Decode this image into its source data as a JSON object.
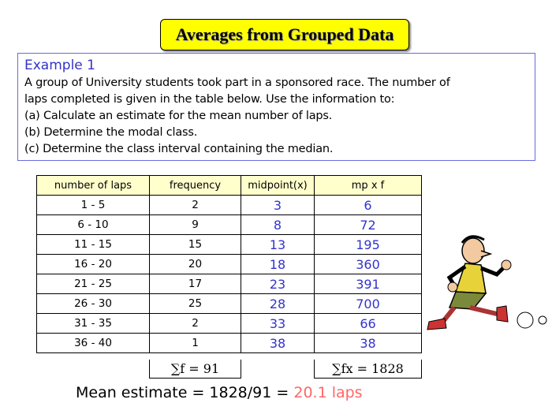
{
  "title": "Averages from Grouped Data",
  "example": {
    "heading": "Example 1",
    "lines": [
      "A group of University students took part in a sponsored race. The number of",
      "laps completed is given in the table below. Use the information to:",
      "(a) Calculate an estimate for the mean number of laps.",
      "(b) Determine the modal class.",
      "(c) Determine the class interval containing the median."
    ]
  },
  "table": {
    "headers": [
      "number of laps",
      "frequency",
      "midpoint(x)",
      "mp x f"
    ],
    "rows": [
      [
        "1 - 5",
        "2",
        "3",
        "6"
      ],
      [
        "6 - 10",
        "9",
        "8",
        "72"
      ],
      [
        "11 - 15",
        "15",
        "13",
        "195"
      ],
      [
        "16 - 20",
        "20",
        "18",
        "360"
      ],
      [
        "21 - 25",
        "17",
        "23",
        "391"
      ],
      [
        "26 - 30",
        "25",
        "28",
        "700"
      ],
      [
        "31 - 35",
        "2",
        "33",
        "66"
      ],
      [
        "36 - 40",
        "1",
        "38",
        "38"
      ]
    ],
    "sum_f": "∑f = 91",
    "sum_fx": "∑fx = 1828"
  },
  "mean": {
    "text": "Mean estimate = 1828/91 = ",
    "answer": "20.1 laps"
  },
  "colors": {
    "title_bg": "#ffff00",
    "blue": "#3333cc",
    "answer": "#ff6666",
    "header_bg": "#ffffcc"
  },
  "illustration": "running-man-cartoon"
}
